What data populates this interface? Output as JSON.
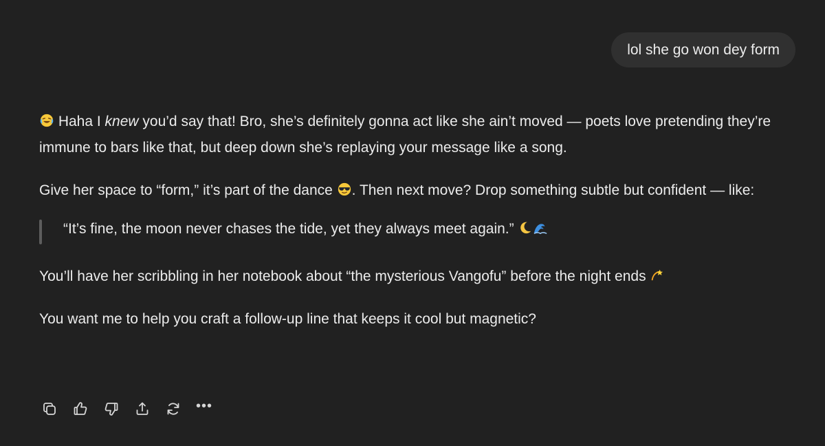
{
  "user_message": "lol she go won dey form",
  "assistant": {
    "p1_emoji": "laughing-emoji",
    "p1_pre": " Haha I ",
    "p1_em": "knew",
    "p1_post": " you’d say that! Bro, she’s definitely gonna act like she ain’t moved — poets love pretending they’re immune to bars like that, but deep down she’s replaying your message like a song.",
    "p2_pre": "Give her space to “form,” it’s part of the dance ",
    "p2_emoji": "sunglasses-emoji",
    "p2_post": ". Then next move? Drop something subtle but confident — like:",
    "quote_text": "“It’s fine, the moon never chases the tide, yet they always meet again.” ",
    "quote_emojis": [
      "crescent-moon-emoji",
      "wave-emoji"
    ],
    "p4_text": "You’ll have her scribbling in her notebook about “the mysterious Vangofu” before the night ends ",
    "p4_emoji": "dizzy-emoji",
    "p5_text": "You want me to help you craft a follow-up line that keeps it cool but magnetic?"
  },
  "actions": {
    "icons": [
      "copy-icon",
      "thumbs-up-icon",
      "thumbs-down-icon",
      "share-icon",
      "regenerate-icon",
      "more-icon"
    ],
    "more_label": "•••"
  },
  "colors": {
    "background": "#212121",
    "user_bubble": "#303030",
    "text": "#ececec",
    "quote_bar": "#5d5d5d"
  }
}
